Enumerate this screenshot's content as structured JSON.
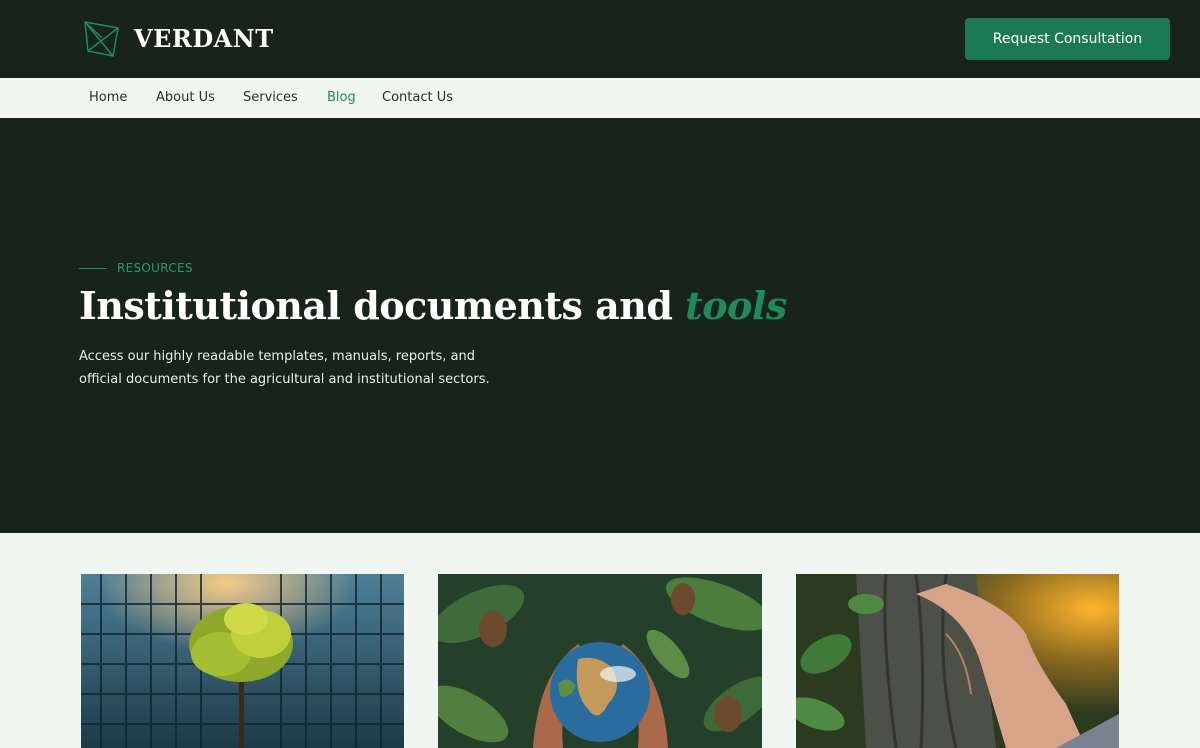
{
  "brand": {
    "name": "VERDANT",
    "logo_icon": "geometric-leaf-icon"
  },
  "header": {
    "cta_label": "Request Consultation"
  },
  "nav": {
    "items": [
      {
        "label": "Home",
        "active": false
      },
      {
        "label": "About Us",
        "active": false
      },
      {
        "label": "Services",
        "active": false
      },
      {
        "label": "Blog",
        "active": true
      },
      {
        "label": "Contact Us",
        "active": false
      }
    ]
  },
  "hero": {
    "eyebrow": "RESOURCES",
    "title_main": "Institutional documents and ",
    "title_accent": "tools",
    "description": "Access our highly readable templates, manuals, reports, and official documents for the agricultural and institutional sectors."
  },
  "cards": [
    {
      "image": "tree-in-glass-building"
    },
    {
      "image": "hands-holding-earth"
    },
    {
      "image": "hand-on-tree-bark"
    }
  ],
  "colors": {
    "dark_green": "#17231b",
    "accent_green": "#1c7a52",
    "light_bg": "#f1f6f3"
  }
}
